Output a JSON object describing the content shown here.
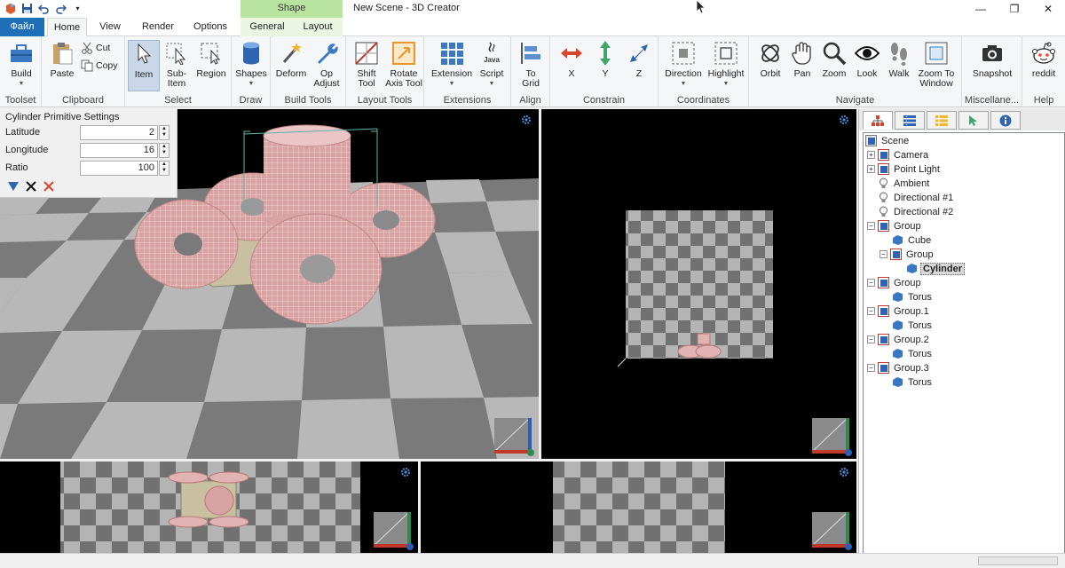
{
  "window": {
    "title": "New Scene - 3D Creator",
    "context_tab_group": "Shape",
    "controls": [
      "—",
      "❐",
      "✕"
    ]
  },
  "tabs": {
    "file": "Файл",
    "home": "Home",
    "view": "View",
    "render": "Render",
    "options": "Options",
    "general": "General",
    "layout": "Layout"
  },
  "ribbon": {
    "toolset": {
      "label": "Toolset",
      "build": "Build"
    },
    "clipboard": {
      "label": "Clipboard",
      "paste": "Paste",
      "cut": "Cut",
      "copy": "Copy"
    },
    "select": {
      "label": "Select",
      "item": "Item",
      "subitem": "Sub-\nItem",
      "region": "Region"
    },
    "draw": {
      "label": "Draw",
      "shapes": "Shapes"
    },
    "build_tools": {
      "label": "Build Tools",
      "deform": "Deform",
      "op_adjust": "Op\nAdjust"
    },
    "layout_tools": {
      "label": "Layout Tools",
      "shift": "Shift\nTool",
      "rotate": "Rotate\nAxis Tool"
    },
    "extensions": {
      "label": "Extensions",
      "extension": "Extension",
      "script": "Script",
      "java": "Java"
    },
    "align": {
      "label": "Align",
      "to_grid": "To\nGrid"
    },
    "constrain": {
      "label": "Constrain",
      "x": "X",
      "y": "Y",
      "z": "Z"
    },
    "coordinates": {
      "label": "Coordinates",
      "direction": "Direction",
      "highlight": "Highlight"
    },
    "navigate": {
      "label": "Navigate",
      "orbit": "Orbit",
      "pan": "Pan",
      "zoom": "Zoom",
      "look": "Look",
      "walk": "Walk",
      "zoom_window": "Zoom To\nWindow"
    },
    "misc": {
      "label": "Miscellane...",
      "snapshot": "Snapshot"
    },
    "help": {
      "label": "Help",
      "reddit": "reddit"
    }
  },
  "settings": {
    "title": "Cylinder Primitive Settings",
    "rows": [
      {
        "label": "Latitude",
        "value": "2"
      },
      {
        "label": "Longitude",
        "value": "16"
      },
      {
        "label": "Ratio",
        "value": "100"
      }
    ]
  },
  "tree": {
    "nodes": [
      {
        "label": "Scene"
      },
      {
        "label": "Camera"
      },
      {
        "label": "Point Light"
      },
      {
        "label": "Ambient"
      },
      {
        "label": "Directional #1"
      },
      {
        "label": "Directional #2"
      },
      {
        "label": "Group"
      },
      {
        "label": "Cube"
      },
      {
        "label": "Group"
      },
      {
        "label": "Cylinder"
      },
      {
        "label": "Group"
      },
      {
        "label": "Torus"
      },
      {
        "label": "Group.1"
      },
      {
        "label": "Torus"
      },
      {
        "label": "Group.2"
      },
      {
        "label": "Torus"
      },
      {
        "label": "Group.3"
      },
      {
        "label": "Torus"
      }
    ]
  },
  "colors": {
    "file_tab": "#1e6fb8",
    "context_group": "#b8e4a0",
    "viewport_bg": "#000000",
    "mesh_pink": "#e8b8b8",
    "floor_light": "#b4b4b4",
    "floor_dark": "#6e6e6e"
  }
}
